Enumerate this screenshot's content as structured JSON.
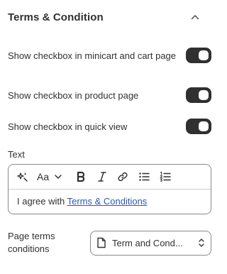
{
  "section": {
    "title": "Terms & Condition"
  },
  "toggles": [
    {
      "label": "Show checkbox in minicart and cart page",
      "enabled": true
    },
    {
      "label": "Show checkbox in product page",
      "enabled": true
    },
    {
      "label": "Show checkbox in quick view",
      "enabled": true
    }
  ],
  "text_field": {
    "label": "Text",
    "toolbar": {
      "icons": [
        "magic-icon",
        "font-size-icon",
        "chevron-down-icon",
        "bold-icon",
        "italic-icon",
        "link-icon",
        "bullet-list-icon",
        "numbered-list-icon"
      ],
      "font_size_glyph": "Aa"
    },
    "content_prefix": "I agree with ",
    "content_link": "Terms & Conditions "
  },
  "page_terms": {
    "label": "Page terms conditions",
    "selected": "Term and Cond..."
  },
  "colors": {
    "text": "#303030",
    "toggle_on": "#303030",
    "link": "#2c58b8",
    "border": "#8a8a8a"
  }
}
